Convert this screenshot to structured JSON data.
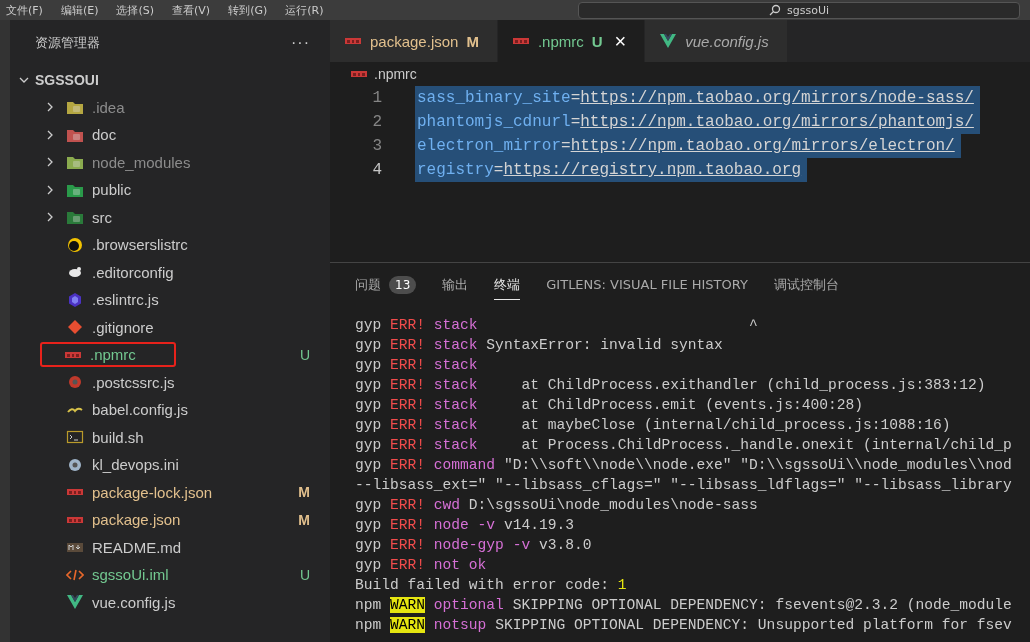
{
  "menu_bar": {
    "items": [
      "文件(F)",
      "编辑(E)",
      "选择(S)",
      "查看(V)",
      "转到(G)",
      "运行(R)"
    ],
    "search": {
      "value": "sgssoUi"
    }
  },
  "sidebar": {
    "title": "资源管理器",
    "more": "···",
    "root": {
      "label": "SGSSOUI",
      "expanded": true
    },
    "items": [
      {
        "label": ".idea",
        "kind": "folder",
        "expanded": false,
        "ignored": true,
        "untracked": false,
        "modified": false,
        "highlighted": false
      },
      {
        "label": "doc",
        "kind": "folder",
        "expanded": false,
        "ignored": false,
        "untracked": false,
        "modified": false,
        "highlighted": false
      },
      {
        "label": "node_modules",
        "kind": "folder",
        "expanded": false,
        "ignored": true,
        "untracked": false,
        "modified": false,
        "highlighted": false
      },
      {
        "label": "public",
        "kind": "folder",
        "expanded": false,
        "ignored": false,
        "untracked": false,
        "modified": false,
        "highlighted": false
      },
      {
        "label": "src",
        "kind": "folder",
        "expanded": false,
        "ignored": false,
        "untracked": false,
        "modified": false,
        "highlighted": false
      },
      {
        "label": ".browserslistrc",
        "kind": "browserslist",
        "ignored": false,
        "untracked": false,
        "modified": false,
        "highlighted": false
      },
      {
        "label": ".editorconfig",
        "kind": "editorconfig",
        "ignored": false,
        "untracked": false,
        "modified": false,
        "highlighted": false
      },
      {
        "label": ".eslintrc.js",
        "kind": "eslint",
        "ignored": false,
        "untracked": false,
        "modified": false,
        "highlighted": false
      },
      {
        "label": ".gitignore",
        "kind": "git",
        "ignored": false,
        "untracked": false,
        "modified": false,
        "highlighted": false
      },
      {
        "label": ".npmrc",
        "kind": "npm",
        "ignored": false,
        "untracked": true,
        "modified": false,
        "badge": "U",
        "highlighted": true
      },
      {
        "label": ".postcssrc.js",
        "kind": "postcss",
        "ignored": false,
        "untracked": false,
        "modified": false,
        "highlighted": false
      },
      {
        "label": "babel.config.js",
        "kind": "babel",
        "ignored": false,
        "untracked": false,
        "modified": false,
        "highlighted": false
      },
      {
        "label": "build.sh",
        "kind": "shell",
        "ignored": false,
        "untracked": false,
        "modified": false,
        "highlighted": false
      },
      {
        "label": "kl_devops.ini",
        "kind": "settings",
        "ignored": false,
        "untracked": false,
        "modified": false,
        "highlighted": false
      },
      {
        "label": "package-lock.json",
        "kind": "npm",
        "ignored": false,
        "untracked": false,
        "modified": true,
        "badge": "M",
        "highlighted": false
      },
      {
        "label": "package.json",
        "kind": "npm",
        "ignored": false,
        "untracked": false,
        "modified": true,
        "badge": "M",
        "highlighted": false
      },
      {
        "label": "README.md",
        "kind": "markdown",
        "ignored": false,
        "untracked": false,
        "modified": false,
        "highlighted": false
      },
      {
        "label": "sgssoUi.iml",
        "kind": "xml",
        "ignored": false,
        "untracked": true,
        "modified": false,
        "badge": "U",
        "highlighted": false
      },
      {
        "label": "vue.config.js",
        "kind": "vue",
        "ignored": false,
        "untracked": false,
        "modified": false,
        "highlighted": false
      }
    ]
  },
  "tabs": [
    {
      "label": "package.json",
      "kind": "npm",
      "untracked": false,
      "modified": true,
      "badge": "M",
      "selected": false,
      "preview": false
    },
    {
      "label": ".npmrc",
      "kind": "npm",
      "untracked": true,
      "modified": false,
      "badge": "U",
      "selected": true,
      "preview": false,
      "close": "×"
    },
    {
      "label": "vue.config.js",
      "kind": "vue",
      "untracked": false,
      "modified": false,
      "selected": false,
      "preview": true
    }
  ],
  "breadcrumb": {
    "label": ".npmrc"
  },
  "editor": {
    "lines": [
      {
        "number": "1",
        "key": "sass_binary_site",
        "equals": "=",
        "value": "https://npm.taobao.org/mirrors/node-sass/",
        "selected": true,
        "current": false
      },
      {
        "number": "2",
        "key": "phantomjs_cdnurl",
        "equals": "=",
        "value": "https://npm.taobao.org/mirrors/phantomjs/",
        "selected": true,
        "current": false
      },
      {
        "number": "3",
        "key": "electron_mirror",
        "equals": "=",
        "value": "https://npm.taobao.org/mirrors/electron/",
        "selected": true,
        "current": false
      },
      {
        "number": "4",
        "key": "registry",
        "equals": "=",
        "value": "https://registry.npm.taobao.org",
        "selected": true,
        "current": true
      }
    ]
  },
  "panel": {
    "tabs": [
      {
        "label": "问题",
        "count": "13",
        "selected": false
      },
      {
        "label": "输出",
        "selected": false
      },
      {
        "label": "终端",
        "selected": true
      },
      {
        "label": "GITLENS: VISUAL FILE HISTORY",
        "selected": false
      },
      {
        "label": "调试控制台",
        "selected": false
      }
    ],
    "terminal": [
      [
        {
          "kind": "plain",
          "text": "gyp "
        },
        {
          "kind": "err",
          "text": "ERR!"
        },
        {
          "kind": "keyword",
          "text": " stack"
        },
        {
          "kind": "plain",
          "text": "                               ^"
        }
      ],
      [
        {
          "kind": "plain",
          "text": "gyp "
        },
        {
          "kind": "err",
          "text": "ERR!"
        },
        {
          "kind": "keyword",
          "text": " stack"
        },
        {
          "kind": "plain",
          "text": " SyntaxError: invalid syntax"
        }
      ],
      [
        {
          "kind": "plain",
          "text": "gyp "
        },
        {
          "kind": "err",
          "text": "ERR!"
        },
        {
          "kind": "keyword",
          "text": " stack"
        }
      ],
      [
        {
          "kind": "plain",
          "text": "gyp "
        },
        {
          "kind": "err",
          "text": "ERR!"
        },
        {
          "kind": "keyword",
          "text": " stack"
        },
        {
          "kind": "plain",
          "text": "     at ChildProcess.exithandler (child_process.js:383:12)"
        }
      ],
      [
        {
          "kind": "plain",
          "text": "gyp "
        },
        {
          "kind": "err",
          "text": "ERR!"
        },
        {
          "kind": "keyword",
          "text": " stack"
        },
        {
          "kind": "plain",
          "text": "     at ChildProcess.emit (events.js:400:28)"
        }
      ],
      [
        {
          "kind": "plain",
          "text": "gyp "
        },
        {
          "kind": "err",
          "text": "ERR!"
        },
        {
          "kind": "keyword",
          "text": " stack"
        },
        {
          "kind": "plain",
          "text": "     at maybeClose (internal/child_process.js:1088:16)"
        }
      ],
      [
        {
          "kind": "plain",
          "text": "gyp "
        },
        {
          "kind": "err",
          "text": "ERR!"
        },
        {
          "kind": "keyword",
          "text": " stack"
        },
        {
          "kind": "plain",
          "text": "     at Process.ChildProcess._handle.onexit (internal/child_p"
        }
      ],
      [
        {
          "kind": "plain",
          "text": "gyp "
        },
        {
          "kind": "err",
          "text": "ERR!"
        },
        {
          "kind": "keyword",
          "text": " command"
        },
        {
          "kind": "plain",
          "text": " \"D:\\\\soft\\\\node\\\\node.exe\" \"D:\\\\sgssoUi\\\\node_modules\\\\nod"
        }
      ],
      [
        {
          "kind": "plain",
          "text": "--libsass_ext=\" \"--libsass_cflags=\" \"--libsass_ldflags=\" \"--libsass_library"
        }
      ],
      [
        {
          "kind": "plain",
          "text": "gyp "
        },
        {
          "kind": "err",
          "text": "ERR!"
        },
        {
          "kind": "keyword",
          "text": " cwd"
        },
        {
          "kind": "plain",
          "text": " D:\\sgssoUi\\node_modules\\node-sass"
        }
      ],
      [
        {
          "kind": "plain",
          "text": "gyp "
        },
        {
          "kind": "err",
          "text": "ERR!"
        },
        {
          "kind": "keyword",
          "text": " node -v"
        },
        {
          "kind": "plain",
          "text": " v14.19.3"
        }
      ],
      [
        {
          "kind": "plain",
          "text": "gyp "
        },
        {
          "kind": "err",
          "text": "ERR!"
        },
        {
          "kind": "keyword",
          "text": " node-gyp -v"
        },
        {
          "kind": "plain",
          "text": " v3.8.0"
        }
      ],
      [
        {
          "kind": "plain",
          "text": "gyp "
        },
        {
          "kind": "err",
          "text": "ERR!"
        },
        {
          "kind": "keyword",
          "text": " not ok"
        }
      ],
      [
        {
          "kind": "plain",
          "text": "Build failed with error code: "
        },
        {
          "kind": "number",
          "text": "1"
        }
      ],
      [
        {
          "kind": "plain",
          "text": "npm "
        },
        {
          "kind": "warn",
          "text": "WARN"
        },
        {
          "kind": "keyword",
          "text": " optional"
        },
        {
          "kind": "plain",
          "text": " SKIPPING OPTIONAL DEPENDENCY: fsevents@2.3.2 (node_module"
        }
      ],
      [
        {
          "kind": "plain",
          "text": "npm "
        },
        {
          "kind": "warn",
          "text": "WARN"
        },
        {
          "kind": "keyword",
          "text": " notsup"
        },
        {
          "kind": "plain",
          "text": " SKIPPING OPTIONAL DEPENDENCY: Unsupported platform for fsev"
        }
      ]
    ]
  }
}
